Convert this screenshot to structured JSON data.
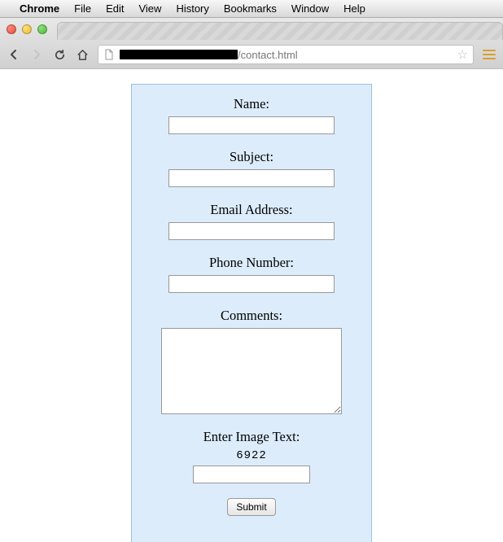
{
  "menubar": {
    "app": "Chrome",
    "items": [
      "File",
      "Edit",
      "View",
      "History",
      "Bookmarks",
      "Window",
      "Help"
    ]
  },
  "url": {
    "path": "/contact.html"
  },
  "form": {
    "name_label": "Name:",
    "subject_label": "Subject:",
    "email_label": "Email Address:",
    "phone_label": "Phone Number:",
    "comments_label": "Comments:",
    "captcha_label": "Enter Image Text:",
    "captcha_value": "6922",
    "submit_label": "Submit",
    "name_value": "",
    "subject_value": "",
    "email_value": "",
    "phone_value": "",
    "comments_value": "",
    "captcha_input_value": ""
  }
}
